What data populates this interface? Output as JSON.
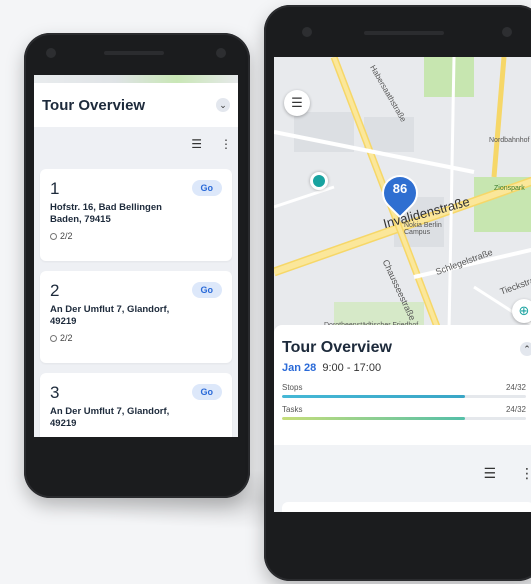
{
  "left_phone": {
    "title": "Tour Overview",
    "collapse_icon": "chevron-down-icon",
    "stops": [
      {
        "number": "1",
        "address": "Hofstr. 16, Bad Bellingen Baden, 79415",
        "progress": "2/2",
        "action": "Go"
      },
      {
        "number": "2",
        "address": "An Der Umflut 7, Glandorf, 49219",
        "progress": "2/2",
        "action": "Go"
      },
      {
        "number": "3",
        "address": "An Der Umflut 7, Glandorf, 49219",
        "progress": "",
        "action": "Go"
      }
    ]
  },
  "right_phone": {
    "map": {
      "marker_label": "86",
      "street_main": "Invalidenstraße",
      "street_2": "Schlegelstraße",
      "street_3": "Chausseestraße",
      "street_4": "Tieckstraße",
      "street_5": "Habersaathstraße",
      "poi_1": "Nordbahnhof",
      "poi_2": "Dorotheenstädtischer Friedhof",
      "poi_3": "Nokia Berlin Campus",
      "poi_4": "Zionspark"
    },
    "panel": {
      "title": "Tour Overview",
      "date": "Jan 28",
      "time": "9:00 - 17:00",
      "stops_label": "Stops",
      "stops_count": "24/32",
      "tasks_label": "Tasks",
      "tasks_count": "24/32",
      "stops_fraction": 0.75,
      "tasks_fraction": 0.75
    }
  },
  "colors": {
    "accent": "#2a6ad8",
    "teal": "#19a3a0",
    "marker": "#2f6fd1"
  }
}
